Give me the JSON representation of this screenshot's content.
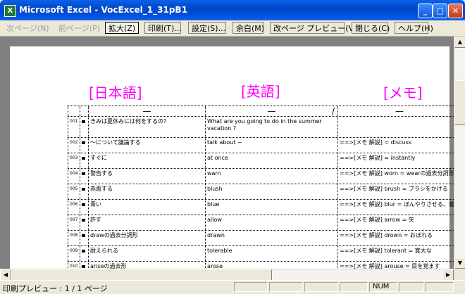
{
  "window": {
    "title": "Microsoft Excel - VocExcel_1_31pB1"
  },
  "toolbar": {
    "next_page": "次ページ(N)",
    "prev_page": "前ページ(P)",
    "zoom": "拡大(Z)",
    "print": "印刷(T)...",
    "setup": "設定(S)...",
    "margins": "余白(M)",
    "page_break": "改ページ プレビュー(V)",
    "close": "閉じる(C)",
    "help": "ヘルプ(H)"
  },
  "headings": {
    "japanese": "[日本語]",
    "english": "[英語]",
    "memo": "[メモ]"
  },
  "header_row": {
    "jp": "—",
    "en": "—",
    "en_mark": "/",
    "memo": "—"
  },
  "rows": [
    {
      "num": "001",
      "jp": "きみは夏休みには何をするの?",
      "en": "What are   you going to  do  in the summer",
      "en2": "vacation ?",
      "memo": ""
    },
    {
      "num": "002",
      "jp": "～について議論する",
      "en": "talk about ~",
      "memo": "==>[メモ  解説] = discuss"
    },
    {
      "num": "003",
      "jp": "すぐに",
      "en": "at once",
      "memo": "==>[メモ  解説] = instantly"
    },
    {
      "num": "004",
      "jp": "警告する",
      "en": "warn",
      "memo": "==>[メモ  解説] worn = wearの過去分詞形"
    },
    {
      "num": "005",
      "jp": "赤面する",
      "en": "blush",
      "memo": "==>[メモ  解説] brush = ブラシをかける"
    },
    {
      "num": "006",
      "jp": "青い",
      "en": "blue",
      "memo": "==>[メモ  解説] blur = ぼんやりさせる、曇り"
    },
    {
      "num": "007",
      "jp": "許す",
      "en": "allow",
      "memo": "==>[メモ  解説] arrow = 矢"
    },
    {
      "num": "008",
      "jp": "drawの過去分詞形",
      "en": "drawn",
      "memo": "==>[メモ  解説] drown = おぼれる"
    },
    {
      "num": "009",
      "jp": "耐えられる",
      "en": "tolerable",
      "memo": "==>[メモ  解説] tolerant = 寛大な"
    },
    {
      "num": "010",
      "jp": "ariseの過去形",
      "en": "arose",
      "memo": "==>[メモ  解説] arouse = 目を覚ます"
    }
  ],
  "status": {
    "text": "印刷プレビュー : 1 / 1 ページ",
    "num": "NUM"
  }
}
